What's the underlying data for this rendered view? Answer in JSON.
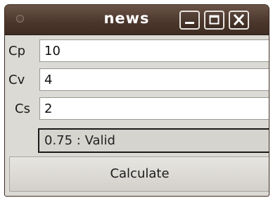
{
  "window": {
    "title": "news"
  },
  "titlebar_buttons": {
    "minimize_icon": "minimize-icon",
    "maximize_icon": "maximize-icon",
    "close_icon": "close-icon"
  },
  "form": {
    "cp": {
      "label": "Cp",
      "value": "10"
    },
    "cv": {
      "label": "Cv",
      "value": "4"
    },
    "cs": {
      "label": "Cs",
      "value": "2"
    },
    "result": "0.75 : Valid",
    "calculate_label": "Calculate"
  },
  "colors": {
    "titlebar": "#4c382d",
    "window_bg": "#dcdad5",
    "title_text": "#ffffff"
  }
}
